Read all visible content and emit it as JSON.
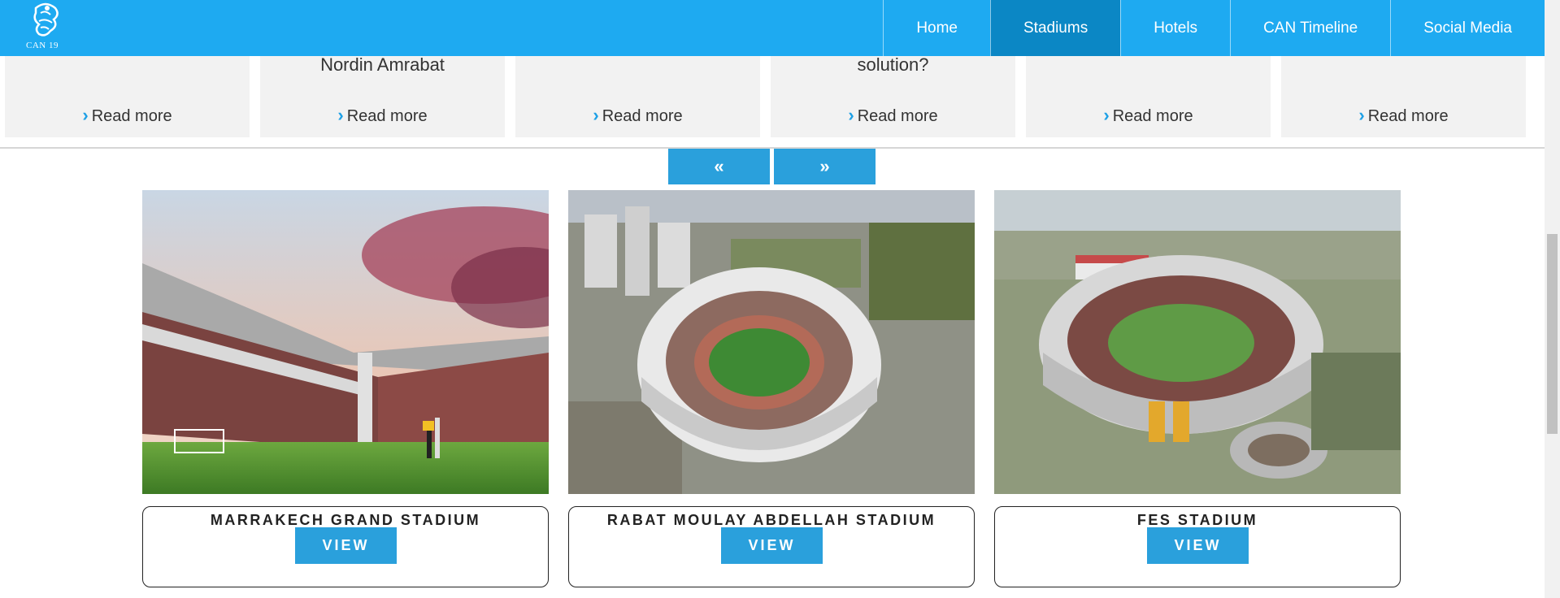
{
  "brand": {
    "logo_text": "CAN 19"
  },
  "nav": {
    "items": [
      {
        "label": "Home"
      },
      {
        "label": "Stadiums",
        "active": true
      },
      {
        "label": "Hotels"
      },
      {
        "label": "CAN Timeline"
      },
      {
        "label": "Social Media"
      }
    ]
  },
  "cards": [
    {
      "title": "",
      "read_more": "Read more"
    },
    {
      "title": "Nordin Amrabat",
      "read_more": "Read more"
    },
    {
      "title": "",
      "read_more": "Read more"
    },
    {
      "title": "solution?",
      "read_more": "Read more"
    },
    {
      "title": "",
      "read_more": "Read more"
    },
    {
      "title": "",
      "read_more": "Read more"
    }
  ],
  "pager": {
    "prev": "«",
    "next": "»"
  },
  "stadiums": [
    {
      "name": "MARRAKECH GRAND STADIUM",
      "button": "VIEW"
    },
    {
      "name": "RABAT MOULAY ABDELLAH STADIUM",
      "button": "VIEW"
    },
    {
      "name": "FES STADIUM",
      "button": "VIEW"
    }
  ],
  "colors": {
    "navbar": "#1eaaf1",
    "active": "#0b87c5",
    "button": "#2aa0dc"
  }
}
